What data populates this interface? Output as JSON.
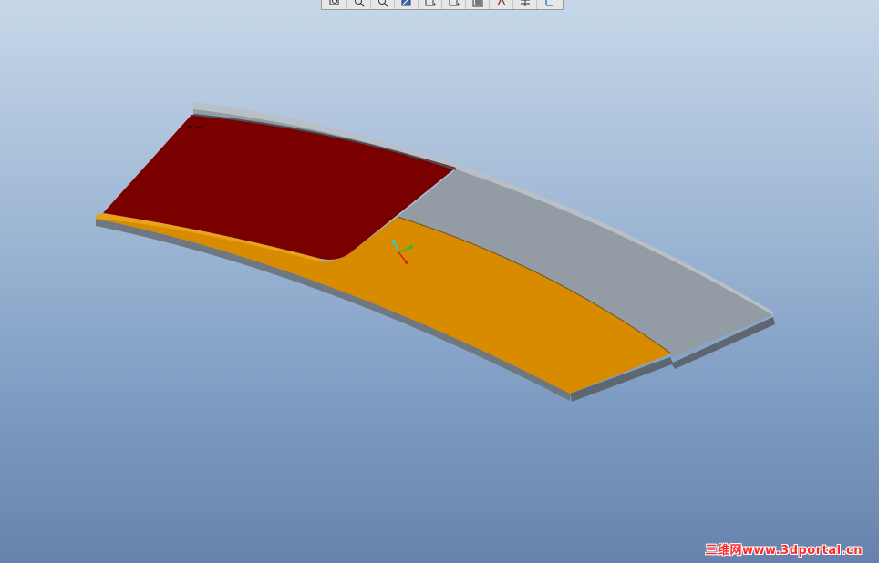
{
  "toolbar": {
    "buttons": [
      {
        "icon": "zoom-window-icon"
      },
      {
        "icon": "zoom-in-icon"
      },
      {
        "icon": "zoom-out-icon"
      },
      {
        "icon": "repaint-icon"
      },
      {
        "icon": "saved-views-icon"
      },
      {
        "icon": "orient-icon"
      },
      {
        "icon": "layers-icon"
      },
      {
        "icon": "spin-center-icon"
      },
      {
        "icon": "datum-display-icon"
      },
      {
        "icon": "csys-display-icon"
      }
    ]
  },
  "model": {
    "colors": {
      "dark_red_face": "#7a0000",
      "orange_face": "#d98b00",
      "gray_face": "#939ba4",
      "edge_dark": "#5e6670",
      "edge_light": "#c9ced4"
    }
  },
  "coordinate_axes": {
    "x_color": "#e02020",
    "y_color": "#20c040",
    "z_color": "#20d0e0"
  },
  "watermark": {
    "text": "三维网www.3dportal.cn"
  }
}
